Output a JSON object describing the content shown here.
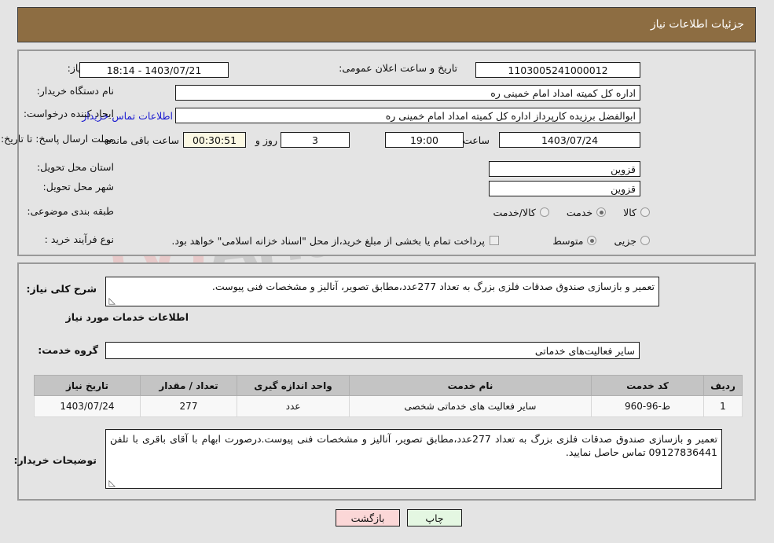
{
  "header": {
    "title": "جزئیات اطلاعات نیاز",
    "bg_color": "#8d6d42",
    "text_color": "#ffffff"
  },
  "watermark": {
    "text": "AriaTender.net",
    "shield_color": "#e9c7c7"
  },
  "main_panel": {
    "need_number": {
      "label": "شماره نیاز:",
      "value": "1103005241000012"
    },
    "announce_datetime": {
      "label": "تاریخ و ساعت اعلان عمومی:",
      "value": "1403/07/21 - 18:14"
    },
    "buyer_org": {
      "label": "نام دستگاه خریدار:",
      "value": "اداره کل کمیته امداد امام خمینی  ره"
    },
    "request_creator": {
      "label": "ایجاد کننده درخواست:",
      "value": "ابوالفضل برزیده کارپرداز اداره کل کمیته امداد امام خمینی  ره"
    },
    "buyer_contact_link": {
      "label": "اطلاعات تماس خریدار",
      "color": "#1a1ad0"
    },
    "deadline": {
      "label": "مهلت ارسال پاسخ: تا تاریخ:",
      "date": "1403/07/24",
      "time_label": "ساعت",
      "time": "19:00",
      "days": "3",
      "days_label": "روز و",
      "countdown": "00:30:51",
      "countdown_label": "ساعت باقی مانده"
    },
    "delivery_province": {
      "label": "استان محل تحویل:",
      "value": "قزوین"
    },
    "delivery_city": {
      "label": "شهر محل تحویل:",
      "value": "قزوین"
    },
    "subject_category": {
      "label": "طبقه بندی موضوعی:",
      "options": [
        {
          "label": "کالا",
          "selected": false
        },
        {
          "label": "خدمت",
          "selected": true
        },
        {
          "label": "کالا/خدمت",
          "selected": false
        }
      ]
    },
    "purchase_process": {
      "label": "نوع فرآیند خرید :",
      "options": [
        {
          "label": "جزیی",
          "selected": false
        },
        {
          "label": "متوسط",
          "selected": true
        }
      ]
    },
    "treasury_note": {
      "checked": false,
      "label": "پرداخت تمام یا بخشی از مبلغ خرید،از محل \"اسناد خزانه اسلامی\" خواهد بود."
    }
  },
  "desc_panel": {
    "general_desc": {
      "label": "شرح کلی نیاز:",
      "value": "تعمیر و بازسازی صندوق صدقات فلزی بزرگ به تعداد 277عدد،مطابق تصویر، آنالیز و مشخصات فنی پیوست."
    },
    "services_heading": "اطلاعات خدمات مورد نیاز",
    "service_group": {
      "label": "گروه خدمت:",
      "value": "سایر فعالیت‌های خدماتی"
    },
    "table": {
      "columns": [
        "ردیف",
        "کد خدمت",
        "نام خدمت",
        "واحد اندازه گیری",
        "تعداد / مقدار",
        "تاریخ نیاز"
      ],
      "rows": [
        {
          "row_no": "1",
          "service_code": "ط-96-960",
          "service_name": "سایر فعالیت های خدماتی شخصی",
          "unit": "عدد",
          "quantity": "277",
          "need_date": "1403/07/24"
        }
      ]
    },
    "buyer_notes": {
      "label": "توضیحات خریدار:",
      "value": "تعمیر و بازسازی صندوق صدقات فلزی بزرگ به تعداد 277عدد،مطابق تصویر، آنالیز و مشخصات فنی پیوست.درصورت ابهام  با آقای باقری با تلفن 09127836441 تماس حاصل نمایید."
    }
  },
  "footer": {
    "print_label": "چاپ",
    "back_label": "بازگشت"
  }
}
